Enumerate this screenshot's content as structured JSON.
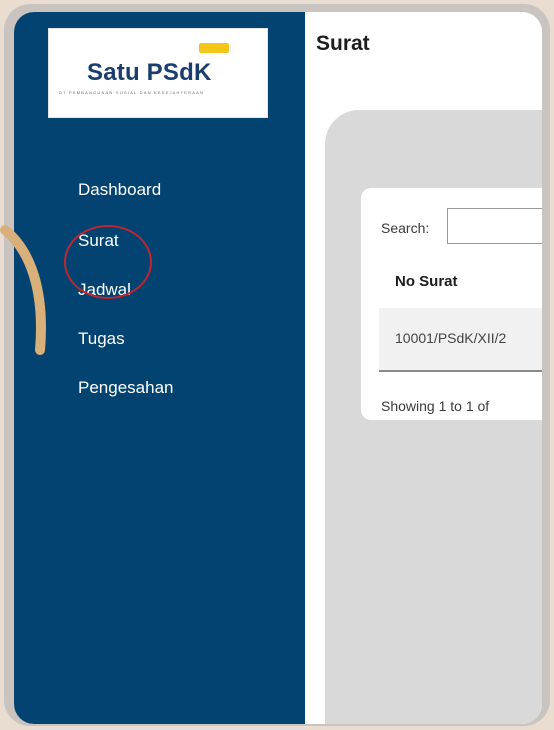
{
  "logo": {
    "name": "Satu PSdK",
    "subtitle": "DT PEMBANGUNAN SOSIAL DAN KESEJAHTERAAN"
  },
  "sidebar": {
    "items": [
      {
        "label": "Dashboard"
      },
      {
        "label": "Surat"
      },
      {
        "label": "Jadwal"
      },
      {
        "label": "Tugas"
      },
      {
        "label": "Pengesahan"
      }
    ]
  },
  "main": {
    "title": "Surat",
    "search_label": "Search:",
    "search_value": "",
    "columns": [
      "No Surat"
    ],
    "rows": [
      [
        "10001/PSdK/XII/2"
      ]
    ],
    "info": "Showing 1 to 1 of"
  },
  "colors": {
    "sidebar_bg": "#034372",
    "highlight": "#c0262d",
    "accent": "#f5c518"
  }
}
